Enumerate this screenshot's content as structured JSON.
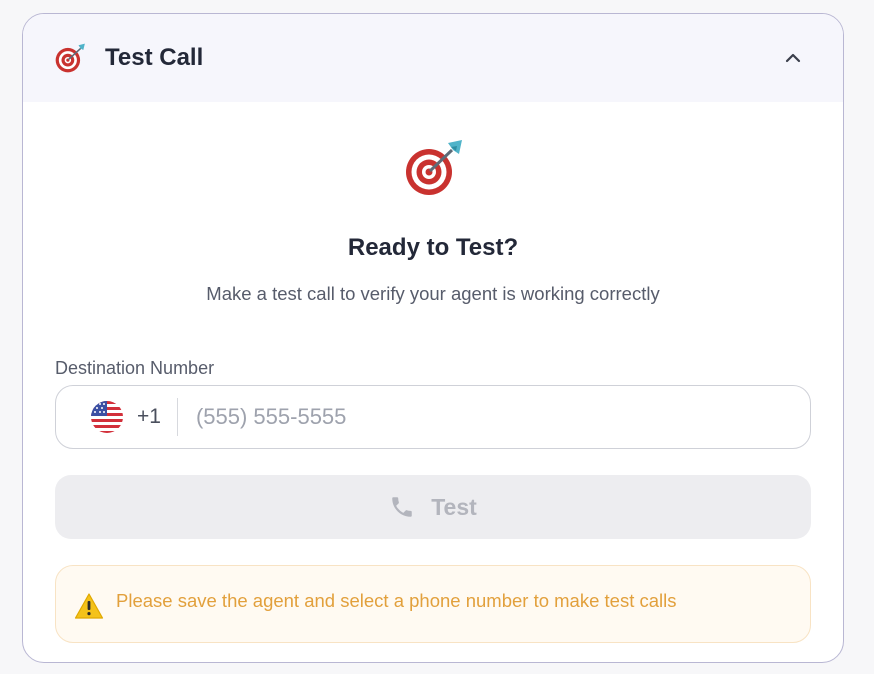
{
  "card": {
    "title": "Test Call",
    "header_icon": "dart-target-icon",
    "collapse_icon": "chevron-up-icon"
  },
  "hero": {
    "icon": "dart-target-icon",
    "title": "Ready to Test?",
    "subtitle": "Make a test call to verify your agent is working correctly"
  },
  "destination": {
    "label": "Destination Number",
    "country_flag": "us-flag-icon",
    "dial_code": "+1",
    "placeholder": "(555) 555-5555",
    "value": ""
  },
  "test_button": {
    "label": "Test",
    "icon": "phone-icon",
    "disabled": true
  },
  "warning": {
    "icon": "warning-icon",
    "text": "Please save the agent and select a phone number to make test calls"
  },
  "colors": {
    "border": "#b9b7d3",
    "header_bg": "#f6f6fc",
    "warning_text": "#e2a03c",
    "warning_bg": "#fffaf2",
    "button_disabled_bg": "#ededf0"
  }
}
